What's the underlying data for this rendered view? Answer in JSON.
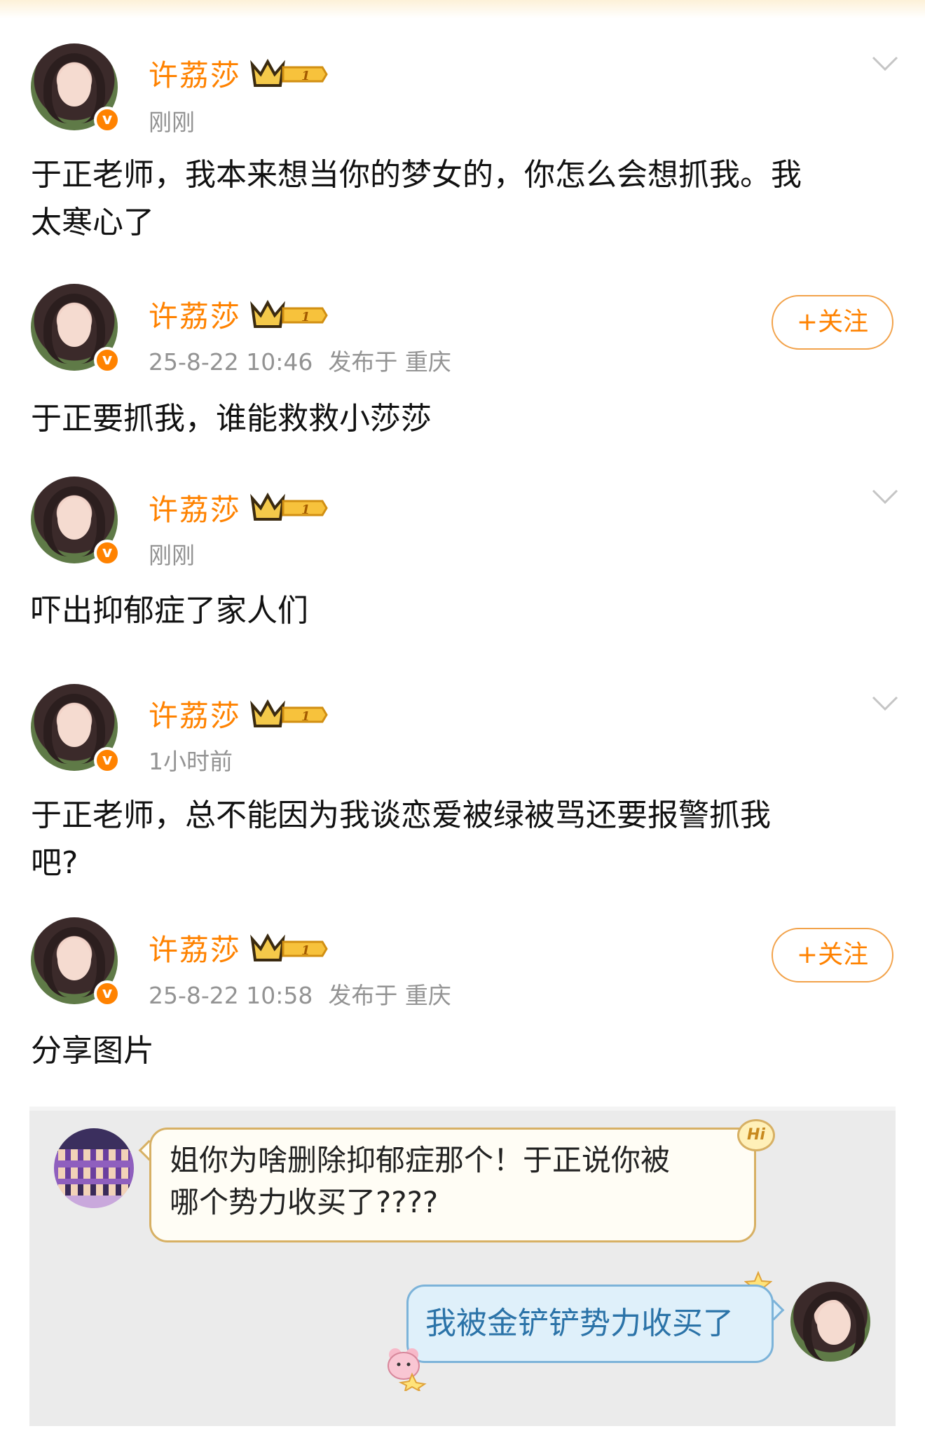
{
  "posts": [
    {
      "username": "许荔莎",
      "level": "1",
      "time": "刚刚",
      "location": "",
      "action": "chevron",
      "text_lines": [
        "于正老师，我本来想当你的梦女的，你怎么会想抓我。我",
        "太寒心了"
      ]
    },
    {
      "username": "许荔莎",
      "level": "1",
      "time": "25-8-22 10:46",
      "location": "发布于 重庆",
      "action": "follow",
      "follow_label": "+关注",
      "text_lines": [
        "于正要抓我，谁能救救小莎莎"
      ]
    },
    {
      "username": "许荔莎",
      "level": "1",
      "time": "刚刚",
      "location": "",
      "action": "chevron",
      "text_lines": [
        "吓出抑郁症了家人们"
      ]
    },
    {
      "username": "许荔莎",
      "level": "1",
      "time": "1小时前",
      "location": "",
      "action": "chevron",
      "text_lines": [
        "于正老师，总不能因为我谈恋爱被绿被骂还要报警抓我",
        "吧?"
      ]
    },
    {
      "username": "许荔莎",
      "level": "1",
      "time": "25-8-22 10:58",
      "location": "发布于 重庆",
      "action": "follow",
      "follow_label": "+关注",
      "text_lines": [
        "分享图片"
      ]
    }
  ],
  "shared_image": {
    "incoming_lines": [
      "姐你为啥删除抑郁症那个！于正说你被",
      "哪个势力收买了????"
    ],
    "hi_badge": "Hi",
    "outgoing_text": "我被金铲铲势力收买了"
  },
  "colors": {
    "accent": "#ff8200",
    "meta": "#939393",
    "text": "#111111",
    "outgoing_text": "#2b73a8"
  }
}
